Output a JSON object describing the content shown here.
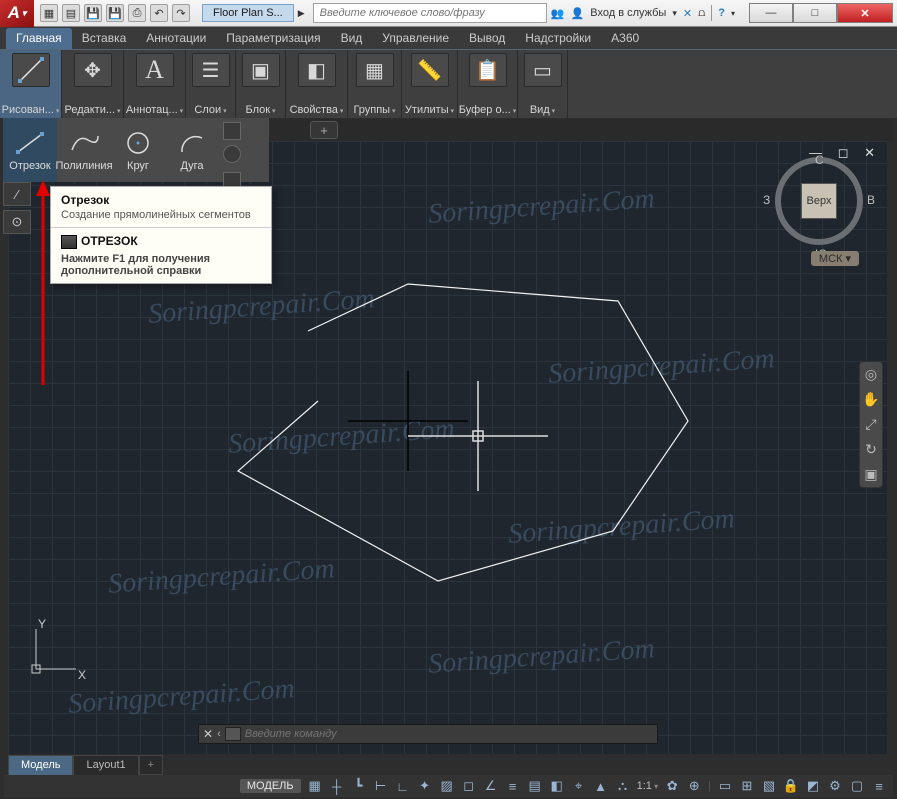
{
  "titlebar": {
    "document_name": "Floor Plan S...",
    "search_placeholder": "Введите ключевое слово/фразу",
    "login_label": "Вход в службы",
    "qat_icons": [
      "new-icon",
      "open-icon",
      "save-icon",
      "saveas-icon",
      "print-icon",
      "undo-icon",
      "redo-icon"
    ]
  },
  "ribbon_tabs": [
    "Главная",
    "Вставка",
    "Аннотации",
    "Параметризация",
    "Вид",
    "Управление",
    "Вывод",
    "Надстройки",
    "A360"
  ],
  "ribbon_panels": [
    {
      "label": "Рисован...",
      "icon": "line",
      "active": true
    },
    {
      "label": "Редакти...",
      "icon": "move"
    },
    {
      "label": "Аннотац...",
      "icon": "A"
    },
    {
      "label": "Слои",
      "icon": "layers"
    },
    {
      "label": "Блок",
      "icon": "block"
    },
    {
      "label": "Свойства",
      "icon": "props"
    },
    {
      "label": "Группы",
      "icon": "group"
    },
    {
      "label": "Утилиты",
      "icon": "util"
    },
    {
      "label": "Буфер о...",
      "icon": "clip"
    },
    {
      "label": "Вид",
      "icon": "view"
    }
  ],
  "draw_tools": [
    {
      "label": "Отрезок",
      "active": true
    },
    {
      "label": "Полилиния"
    },
    {
      "label": "Круг"
    },
    {
      "label": "Дуга"
    }
  ],
  "tooltip": {
    "title": "Отрезок",
    "description": "Создание прямолинейных сегментов",
    "command": "ОТРЕЗОК",
    "help": "Нажмите F1 для получения дополнительной справки"
  },
  "doc_tabs": {
    "plus": "+"
  },
  "viewcube": {
    "face": "Верх",
    "n": "С",
    "s": "Ю",
    "e": "В",
    "w": "З"
  },
  "msk_label": "МСК",
  "canvas_win_buttons": "—  ◻  ✕",
  "ucs": {
    "x": "X",
    "y": "Y"
  },
  "command_line": {
    "placeholder": "Введите команду",
    "close": "✕",
    "chev": "‹"
  },
  "layout_tabs": {
    "model": "Модель",
    "layout": "Layout1",
    "plus": "+"
  },
  "statusbar": {
    "model": "МОДЕЛЬ",
    "ratio": "1:1",
    "icons": [
      "grid-icon",
      "snap-icon",
      "infer-icon",
      "dynamic-icon",
      "ortho-icon",
      "polar-icon",
      "iso-icon",
      "osnap-icon",
      "anno-icon",
      "auto-icon",
      "ws-icon",
      "monitor-icon",
      "units-icon",
      "quick-icon",
      "lock-icon",
      "iso2-icon",
      "hardware-icon",
      "clean-icon",
      "menu-icon"
    ]
  },
  "watermark_text": "Soringpcrepair.Com"
}
